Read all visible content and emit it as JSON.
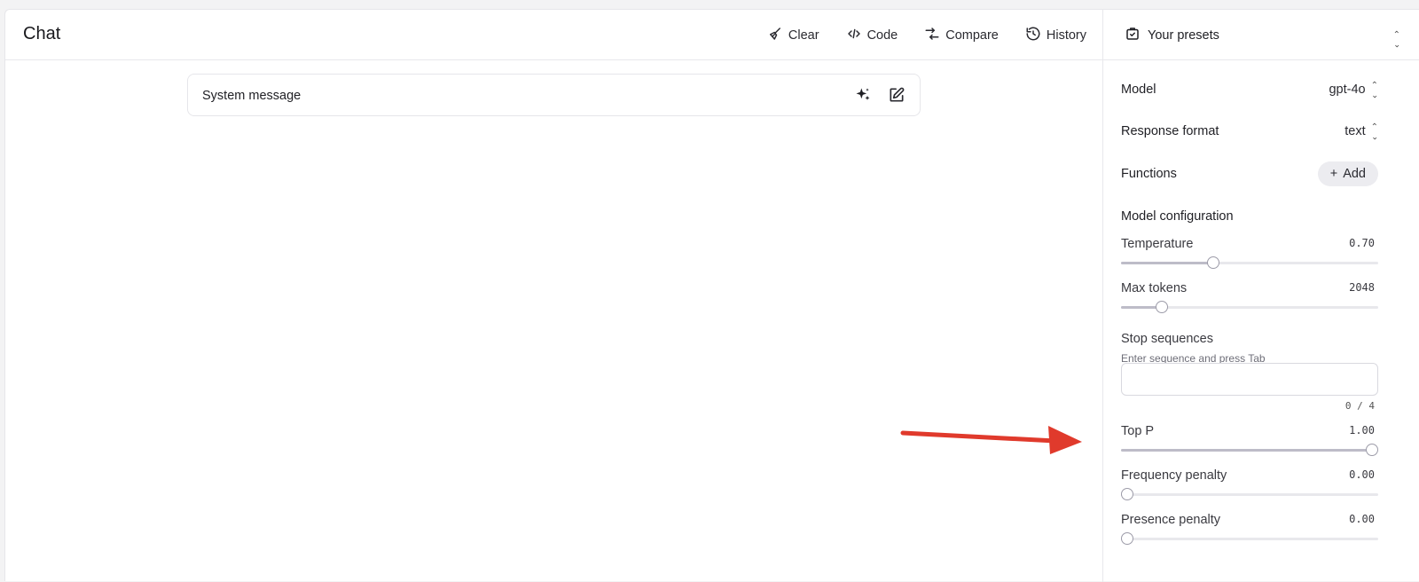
{
  "header": {
    "title": "Chat",
    "toolbar": [
      {
        "label": "Clear",
        "icon": "broom-icon"
      },
      {
        "label": "Code",
        "icon": "code-icon"
      },
      {
        "label": "Compare",
        "icon": "compare-icon"
      },
      {
        "label": "History",
        "icon": "history-icon"
      }
    ]
  },
  "system_message": {
    "label": "System message"
  },
  "presets": {
    "label": "Your presets"
  },
  "settings": {
    "model": {
      "label": "Model",
      "value": "gpt-4o"
    },
    "response_format": {
      "label": "Response format",
      "value": "text"
    },
    "functions": {
      "label": "Functions",
      "add_label": "Add"
    },
    "section_title": "Model configuration",
    "sliders": [
      {
        "label": "Temperature",
        "display": "0.70",
        "fraction": 0.35
      },
      {
        "label": "Max tokens",
        "display": "2048",
        "fraction": 0.14
      },
      {
        "label": "Top P",
        "display": "1.00",
        "fraction": 1.0
      },
      {
        "label": "Frequency penalty",
        "display": "0.00",
        "fraction": 0.0
      },
      {
        "label": "Presence penalty",
        "display": "0.00",
        "fraction": 0.0
      }
    ],
    "stop_sequences": {
      "label": "Stop sequences",
      "hint": "Enter sequence and press Tab",
      "value": "",
      "count": "0 / 4"
    }
  },
  "colors": {
    "annotation_arrow": "#e03a2c"
  }
}
